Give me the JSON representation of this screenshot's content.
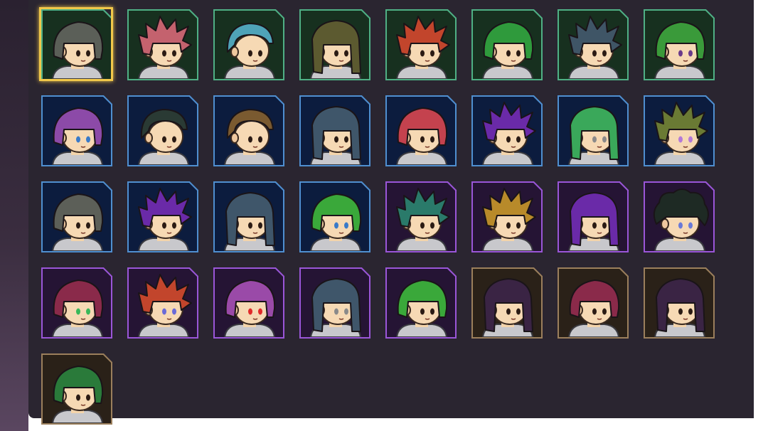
{
  "selected_index": 0,
  "colors": {
    "green": "#4fb085",
    "blue": "#4f8fd0",
    "purple": "#9a56d8",
    "gold": "#9b7f5c",
    "selection": "#f2c84a"
  },
  "characters": [
    {
      "rarity": "green",
      "hair": "#5b5f58",
      "eyes": "#2b1b14",
      "style": "bob"
    },
    {
      "rarity": "green",
      "hair": "#c4626e",
      "eyes": "#2b1b14",
      "style": "spiky"
    },
    {
      "rarity": "green",
      "hair": "#4fa3b8",
      "eyes": "#2b1b14",
      "style": "short"
    },
    {
      "rarity": "green",
      "hair": "#5c5a30",
      "eyes": "#2b1b14",
      "style": "long"
    },
    {
      "rarity": "green",
      "hair": "#c2452c",
      "eyes": "#2b1b14",
      "style": "spiky"
    },
    {
      "rarity": "green",
      "hair": "#2f9a3c",
      "eyes": "#2b1b14",
      "style": "bob"
    },
    {
      "rarity": "green",
      "hair": "#3f5566",
      "eyes": "#2b1b14",
      "style": "spiky"
    },
    {
      "rarity": "green",
      "hair": "#3a9a3a",
      "eyes": "#6a3a8a",
      "style": "bob"
    },
    {
      "rarity": "blue",
      "hair": "#8c4aa8",
      "eyes": "#3a7ac8",
      "style": "bob"
    },
    {
      "rarity": "blue",
      "hair": "#2a3a34",
      "eyes": "#2b1b14",
      "style": "short"
    },
    {
      "rarity": "blue",
      "hair": "#7a5a30",
      "eyes": "#2b1b14",
      "style": "short"
    },
    {
      "rarity": "blue",
      "hair": "#3f566a",
      "eyes": "#2b1b14",
      "style": "long"
    },
    {
      "rarity": "blue",
      "hair": "#c4424e",
      "eyes": "#2b1b14",
      "style": "bob"
    },
    {
      "rarity": "blue",
      "hair": "#6a2aa8",
      "eyes": "#2b1b14",
      "style": "spiky"
    },
    {
      "rarity": "blue",
      "hair": "#3aa85a",
      "eyes": "#8a8a8a",
      "style": "long"
    },
    {
      "rarity": "blue",
      "hair": "#6a7a34",
      "eyes": "#b47ad8",
      "style": "spiky"
    },
    {
      "rarity": "blue",
      "hair": "#5c5f58",
      "eyes": "#2b1b14",
      "style": "bob"
    },
    {
      "rarity": "blue",
      "hair": "#6a2aa8",
      "eyes": "#2b1b14",
      "style": "spiky"
    },
    {
      "rarity": "blue",
      "hair": "#3f566a",
      "eyes": "#2b1b14",
      "style": "long"
    },
    {
      "rarity": "blue",
      "hair": "#3aa83a",
      "eyes": "#3a7ac8",
      "style": "bob"
    },
    {
      "rarity": "purple",
      "hair": "#2a7a6a",
      "eyes": "#2b1b14",
      "style": "spiky"
    },
    {
      "rarity": "purple",
      "hair": "#b88a2a",
      "eyes": "#2b1b14",
      "style": "spiky"
    },
    {
      "rarity": "purple",
      "hair": "#6a2aa8",
      "eyes": "#2b1b14",
      "style": "long"
    },
    {
      "rarity": "purple",
      "hair": "#1e2a24",
      "eyes": "#6a7ad8",
      "style": "curly"
    },
    {
      "rarity": "purple",
      "hair": "#8a2a4a",
      "eyes": "#3ab85a",
      "style": "bob"
    },
    {
      "rarity": "purple",
      "hair": "#c2452c",
      "eyes": "#6a6ad8",
      "style": "spiky"
    },
    {
      "rarity": "purple",
      "hair": "#9a4aa8",
      "eyes": "#e02a2a",
      "style": "bob"
    },
    {
      "rarity": "purple",
      "hair": "#3f566a",
      "eyes": "#8a8a8a",
      "style": "long"
    },
    {
      "rarity": "purple",
      "hair": "#3aa83a",
      "eyes": "#2b1b14",
      "style": "bob"
    },
    {
      "rarity": "gold",
      "hair": "#3a2444",
      "eyes": "#2b1b14",
      "style": "long"
    },
    {
      "rarity": "gold",
      "hair": "#8a2a4a",
      "eyes": "#2b1b14",
      "style": "bob"
    },
    {
      "rarity": "gold",
      "hair": "#3a2444",
      "eyes": "#2b1b14",
      "style": "long"
    },
    {
      "rarity": "gold",
      "hair": "#2a7a3a",
      "eyes": "#2b1b14",
      "style": "bob"
    }
  ]
}
